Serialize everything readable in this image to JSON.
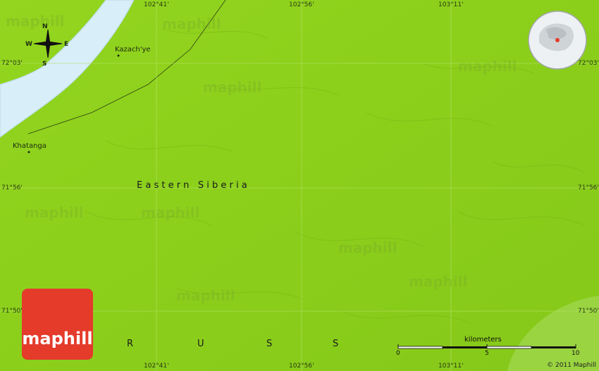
{
  "map": {
    "land_color": "#8fd11d",
    "water_color": "#d8eef8",
    "places": [
      {
        "name": "Kazach'ye"
      },
      {
        "name": "Khatanga"
      }
    ],
    "region_label": "E a s t e r n   S i b e r i a",
    "country_letters": [
      "R",
      "U",
      "S",
      "S"
    ],
    "coords": {
      "top_1": "102°41'",
      "top_2": "102°56'",
      "top_3": "103°11'",
      "bottom_1": "102°41'",
      "bottom_2": "102°56'",
      "bottom_3": "103°11'",
      "left_1": "72°03'",
      "left_2": "71°56'",
      "left_3": "71°50'",
      "right_1": "72°03'",
      "right_2": "71°56'",
      "right_3": "71°50'"
    },
    "compass": {
      "n": "N",
      "s": "S",
      "e": "E",
      "w": "W"
    },
    "watermark": "maphill",
    "brand": "maphill",
    "scale": {
      "title": "kilometers",
      "ticks": [
        "0",
        "5",
        "10"
      ]
    },
    "copyright": "© 2011 Maphill"
  }
}
